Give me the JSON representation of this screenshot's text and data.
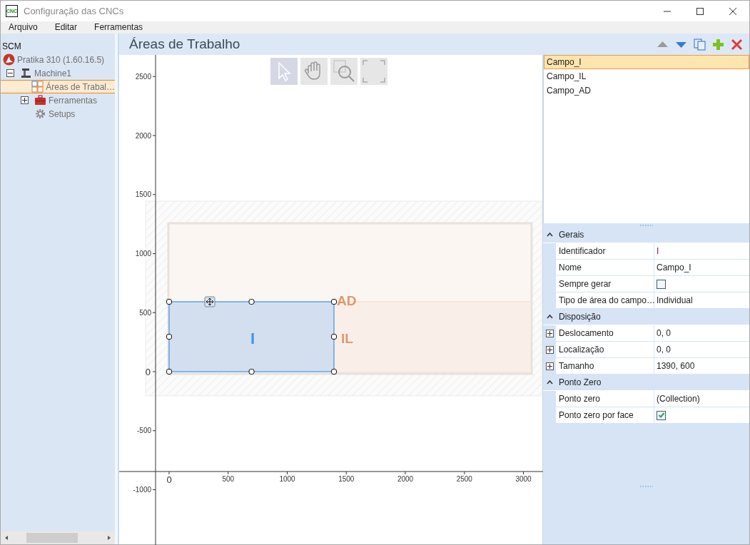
{
  "window": {
    "title": "Configuração das CNCs",
    "icon_text": "CNC"
  },
  "menu": [
    "Arquivo",
    "Editar",
    "Ferramentas"
  ],
  "tree": {
    "title": "SCM",
    "items": [
      {
        "label": "Pratika 310 (1.60.16.5)",
        "kind": "logo",
        "selected": false,
        "children": [
          {
            "label": "Machine1",
            "kind": "machine",
            "expanded": true,
            "selected": false,
            "children": [
              {
                "label": "Áreas de Trabal…",
                "kind": "grid",
                "selected": true
              },
              {
                "label": "Ferramentas",
                "kind": "toolbox",
                "expanded": false,
                "selected": false
              },
              {
                "label": "Setups",
                "kind": "gear",
                "selected": false
              }
            ]
          }
        ]
      }
    ]
  },
  "header": {
    "title": "Áreas de Trabalho"
  },
  "list_toolbar": [
    {
      "kind": "up",
      "disabled": true
    },
    {
      "kind": "down",
      "disabled": false
    },
    {
      "kind": "copy",
      "disabled": false
    },
    {
      "kind": "add",
      "disabled": false
    },
    {
      "kind": "delete",
      "disabled": false
    }
  ],
  "canvas_tools": [
    {
      "kind": "pointer",
      "selected": true
    },
    {
      "kind": "pan",
      "selected": false
    },
    {
      "kind": "zoom",
      "selected": false
    },
    {
      "kind": "fit",
      "selected": false
    }
  ],
  "canvas": {
    "y_ticks": [
      "2500",
      "2000",
      "1500",
      "1000",
      "500",
      "0",
      "-500",
      "-1000"
    ],
    "x_ticks": [
      "0",
      "500",
      "1000",
      "1500",
      "2000",
      "2500",
      "3000"
    ],
    "areas": [
      {
        "label": "AD",
        "selected": false
      },
      {
        "label": "IL",
        "selected": false
      },
      {
        "label": "I",
        "selected": true
      }
    ]
  },
  "areas_list": [
    {
      "label": "Campo_I",
      "selected": true
    },
    {
      "label": "Campo_IL",
      "selected": false
    },
    {
      "label": "Campo_AD",
      "selected": false
    }
  ],
  "properties": [
    {
      "category": "Gerais",
      "expanded": true,
      "rows": [
        {
          "label": "Identificador",
          "kind": "text",
          "value": "I"
        },
        {
          "label": "Nome",
          "kind": "text",
          "value": "Campo_I"
        },
        {
          "label": "Sempre gerar",
          "kind": "checkbox",
          "checked": false
        },
        {
          "label": "Tipo de área do campo…",
          "kind": "text",
          "value": "Individual"
        }
      ]
    },
    {
      "category": "Disposição",
      "expanded": true,
      "rows": [
        {
          "label": "Deslocamento",
          "kind": "text",
          "value": "0, 0",
          "expandable": true
        },
        {
          "label": "Localização",
          "kind": "text",
          "value": "0, 0",
          "expandable": true
        },
        {
          "label": "Tamanho",
          "kind": "text",
          "value": "1390, 600",
          "expandable": true
        }
      ]
    },
    {
      "category": "Ponto Zero",
      "expanded": true,
      "rows": [
        {
          "label": "Ponto zero",
          "kind": "text",
          "value": "(Collection)"
        },
        {
          "label": "Ponto zero por face",
          "kind": "checkbox",
          "checked": true
        }
      ]
    }
  ]
}
